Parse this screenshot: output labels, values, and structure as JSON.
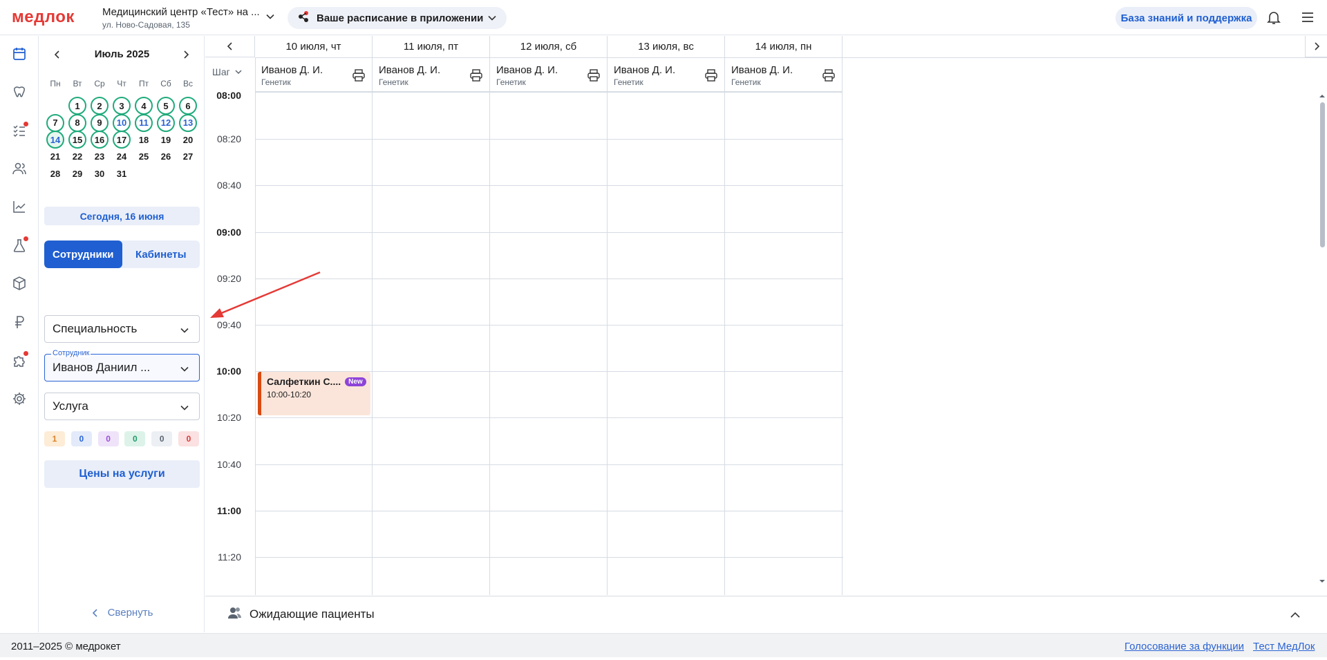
{
  "header": {
    "logo": "медлок",
    "clinic_name": "Медицинский центр «Тест» на ...",
    "clinic_address": "ул. Ново-Садовая, 135",
    "app_promo": "Ваше расписание в приложении",
    "knowledge_base": "База знаний и поддержка"
  },
  "rail": {
    "icons": [
      "calendar-icon",
      "tooth-icon",
      "tasks-icon",
      "users-icon",
      "chart-icon",
      "flask-icon",
      "box-icon",
      "ruble-icon",
      "puzzle-icon",
      "gear-icon"
    ]
  },
  "calendar": {
    "title": "Июль 2025",
    "weekdays": [
      "Пн",
      "Вт",
      "Ср",
      "Чт",
      "Пт",
      "Сб",
      "Вс"
    ],
    "days": [
      {
        "d": "1",
        "ring": true
      },
      {
        "d": "2",
        "ring": true
      },
      {
        "d": "3",
        "ring": true
      },
      {
        "d": "4",
        "ring": true
      },
      {
        "d": "5",
        "ring": true
      },
      {
        "d": "6",
        "ring": true
      },
      {
        "d": "7",
        "ring": true
      },
      {
        "d": "8",
        "ring": true
      },
      {
        "d": "9",
        "ring": true
      },
      {
        "d": "10",
        "ring": true,
        "hl": true
      },
      {
        "d": "11",
        "ring": true,
        "hl": true
      },
      {
        "d": "12",
        "ring": true,
        "hl": true
      },
      {
        "d": "13",
        "ring": true,
        "hl": true
      },
      {
        "d": "14",
        "ring": true,
        "hl": true,
        "today": true
      },
      {
        "d": "15",
        "ring": true
      },
      {
        "d": "16",
        "ring": true
      },
      {
        "d": "17",
        "ring": true
      },
      {
        "d": "18"
      },
      {
        "d": "19"
      },
      {
        "d": "20"
      },
      {
        "d": "21"
      },
      {
        "d": "22"
      },
      {
        "d": "23"
      },
      {
        "d": "24"
      },
      {
        "d": "25"
      },
      {
        "d": "26"
      },
      {
        "d": "27"
      },
      {
        "d": "28"
      },
      {
        "d": "29"
      },
      {
        "d": "30"
      },
      {
        "d": "31"
      }
    ],
    "first_weekday_offset": 1,
    "today_button": "Сегодня, 16 июня"
  },
  "tabs": {
    "employees": "Сотрудники",
    "cabinets": "Кабинеты",
    "active": "employees"
  },
  "filters": {
    "specialty": "Специальность",
    "employee_label": "Сотрудник",
    "employee_value": "Иванов Даниил ...",
    "service": "Услуга"
  },
  "counters": [
    {
      "value": "1",
      "bg": "#fdecd6",
      "fg": "#d9822b"
    },
    {
      "value": "0",
      "bg": "#e3ebfa",
      "fg": "#2a63d4"
    },
    {
      "value": "0",
      "bg": "#efe3fa",
      "fg": "#9a4fd6"
    },
    {
      "value": "0",
      "bg": "#ddf3ea",
      "fg": "#1f9a6a"
    },
    {
      "value": "0",
      "bg": "#eceff3",
      "fg": "#5a6470"
    },
    {
      "value": "0",
      "bg": "#fbe1e1",
      "fg": "#d93a3a"
    }
  ],
  "prices_button": "Цены на услуги",
  "collapse": "Свернуть",
  "schedule": {
    "step_label": "Шаг",
    "days": [
      {
        "date": "10 июля, чт",
        "person": "Иванов Д. И.",
        "role": "Генетик"
      },
      {
        "date": "11 июля, пт",
        "person": "Иванов Д. И.",
        "role": "Генетик"
      },
      {
        "date": "12 июля, сб",
        "person": "Иванов Д. И.",
        "role": "Генетик"
      },
      {
        "date": "13 июля, вс",
        "person": "Иванов Д. И.",
        "role": "Генетик"
      },
      {
        "date": "14 июля, пн",
        "person": "Иванов Д. И.",
        "role": "Генетик"
      }
    ],
    "times": [
      {
        "t": "08:00",
        "major": true
      },
      {
        "t": "08:20"
      },
      {
        "t": "08:40"
      },
      {
        "t": "09:00",
        "major": true
      },
      {
        "t": "09:20"
      },
      {
        "t": "09:40"
      },
      {
        "t": "10:00",
        "major": true
      },
      {
        "t": "10:20"
      },
      {
        "t": "10:40"
      },
      {
        "t": "11:00",
        "major": true
      },
      {
        "t": "11:20"
      }
    ],
    "appointment": {
      "name": "Салфеткин С....",
      "badge": "New",
      "time": "10:00-10:20"
    }
  },
  "waiting": "Ожидающие пациенты",
  "footer": {
    "copyright": "2011–2025 © медрокет",
    "vote": "Голосование за функции",
    "test": "Тест МедЛок"
  },
  "colors": {
    "brand": "#e53935",
    "accent": "#1f5fd1",
    "ring": "#1faa7a",
    "appointment": "#d84b12",
    "annotation_arrow": "#e53935"
  }
}
